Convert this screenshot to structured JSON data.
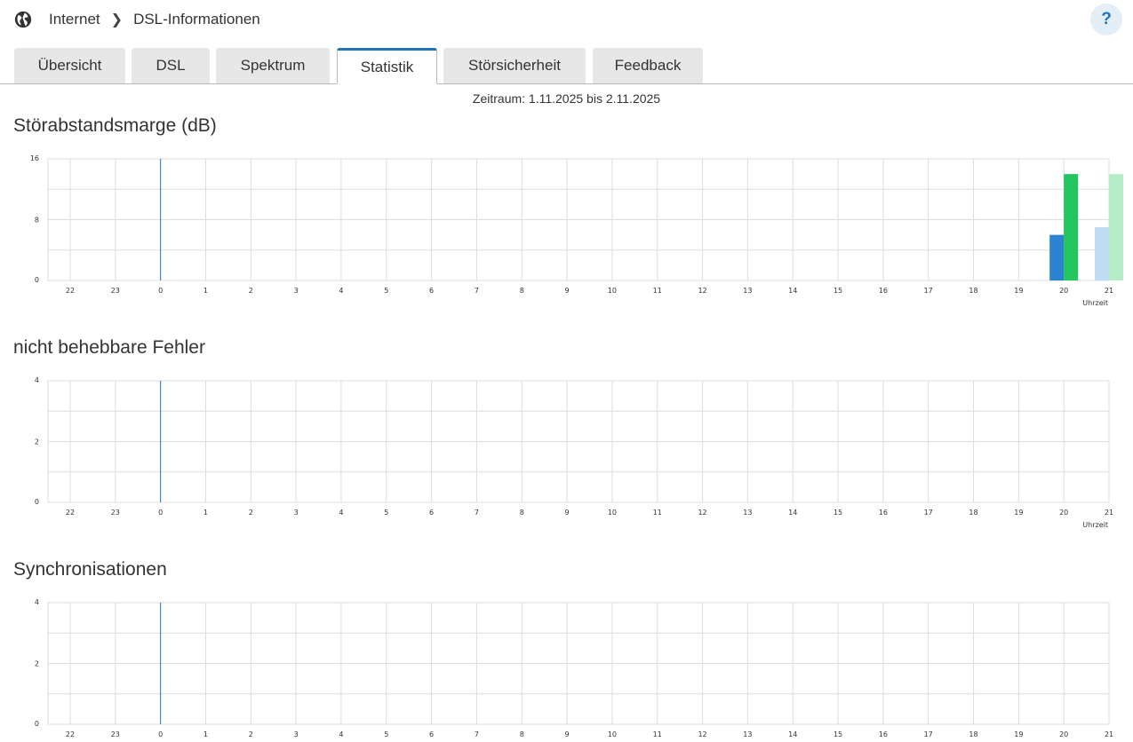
{
  "breadcrumb": {
    "icon": "globe-icon",
    "items": [
      "Internet",
      "DSL-Informationen"
    ]
  },
  "help": {
    "label": "?"
  },
  "tabs": [
    {
      "label": "Übersicht",
      "active": false
    },
    {
      "label": "DSL",
      "active": false
    },
    {
      "label": "Spektrum",
      "active": false
    },
    {
      "label": "Statistik",
      "active": true
    },
    {
      "label": "Störsicherheit",
      "active": false
    },
    {
      "label": "Feedback",
      "active": false
    }
  ],
  "period": "Zeitraum: 1.11.2025 bis 2.11.2025",
  "colors": {
    "accent": "#1e73be",
    "downstream": "#2a84d2",
    "upstream": "#22c55e",
    "downstream_light": "#c0dcf2",
    "upstream_light": "#b6ebc7",
    "grid": "#dddddd"
  },
  "sections": [
    {
      "title": "Störabstandsmarge (dB)"
    },
    {
      "title": "nicht behebbare Fehler"
    },
    {
      "title": "Synchronisationen"
    }
  ],
  "chart_data": [
    {
      "type": "bar",
      "title": "Störabstandsmarge (dB)",
      "xlabel": "Uhrzeit",
      "x_ticks": [
        "22",
        "23",
        "0",
        "1",
        "2",
        "3",
        "4",
        "5",
        "6",
        "7",
        "8",
        "9",
        "10",
        "11",
        "12",
        "13",
        "14",
        "15",
        "16",
        "17",
        "18",
        "19",
        "20",
        "21"
      ],
      "y_ticks": [
        0,
        8,
        16
      ],
      "ylim": [
        0,
        16
      ],
      "grid": true,
      "series": [
        {
          "category": "20",
          "values": [
            6,
            14
          ],
          "colors": [
            "#2a84d2",
            "#22c55e"
          ]
        },
        {
          "category": "21",
          "values": [
            7,
            14
          ],
          "colors": [
            "#c0dcf2",
            "#b6ebc7"
          ]
        }
      ]
    },
    {
      "type": "bar",
      "title": "nicht behebbare Fehler",
      "xlabel": "Uhrzeit",
      "x_ticks": [
        "22",
        "23",
        "0",
        "1",
        "2",
        "3",
        "4",
        "5",
        "6",
        "7",
        "8",
        "9",
        "10",
        "11",
        "12",
        "13",
        "14",
        "15",
        "16",
        "17",
        "18",
        "19",
        "20",
        "21"
      ],
      "y_ticks": [
        0,
        2,
        4
      ],
      "ylim": [
        0,
        4
      ],
      "grid": true,
      "series": []
    },
    {
      "type": "bar",
      "title": "Synchronisationen",
      "xlabel": "",
      "x_ticks": [
        "22",
        "23",
        "0",
        "1",
        "2",
        "3",
        "4",
        "5",
        "6",
        "7",
        "8",
        "9",
        "10",
        "11",
        "12",
        "13",
        "14",
        "15",
        "16",
        "17",
        "18",
        "19",
        "20",
        "21"
      ],
      "y_ticks": [
        0,
        2,
        4
      ],
      "ylim": [
        0,
        4
      ],
      "grid": true,
      "series": []
    }
  ]
}
